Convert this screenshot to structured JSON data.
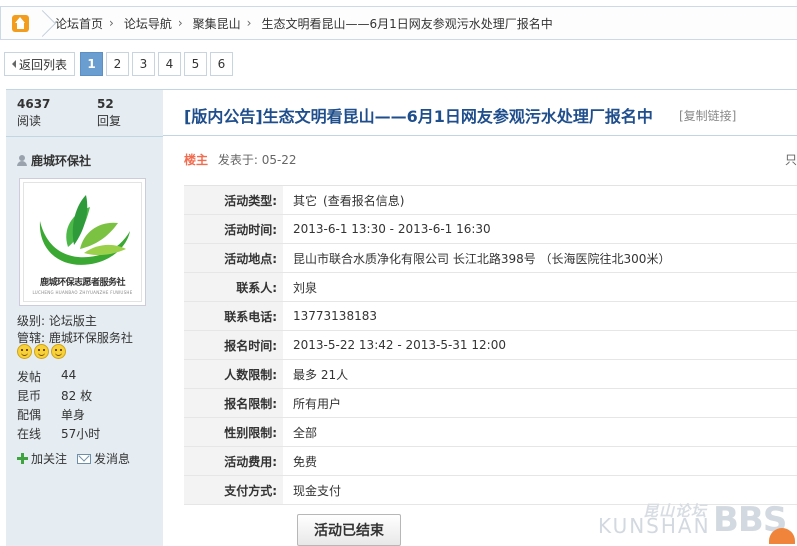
{
  "breadcrumb": {
    "items": [
      "论坛首页",
      "论坛导航",
      "聚集昆山",
      "生态文明看昆山——6月1日网友参观污水处理厂报名中"
    ],
    "separator": "›"
  },
  "pager": {
    "back_label": "返回列表",
    "pages": [
      "1",
      "2",
      "3",
      "4",
      "5",
      "6"
    ],
    "active_page": "1"
  },
  "stats": {
    "views_value": "4637",
    "views_label": "阅读",
    "replies_value": "52",
    "replies_label": "回复"
  },
  "author": {
    "name": "鹿城环保社",
    "avatar_text": "鹿城环保志愿者服务社",
    "avatar_subtext": "LUCHENG HUANBAO ZHIYUANZHE FUWUSHE",
    "level": "级别: 论坛版主",
    "manage": "管辖: 鹿城环保服务社",
    "fields": [
      {
        "key": "发帖",
        "value": "44"
      },
      {
        "key": "昆币",
        "value": "82 枚"
      },
      {
        "key": "配偶",
        "value": "单身"
      },
      {
        "key": "在线",
        "value": "57小时"
      }
    ],
    "follow_label": "加关注",
    "message_label": "发消息"
  },
  "thread": {
    "title": "[版内公告]生态文明看昆山——6月1日网友参观污水处理厂报名中",
    "copy_link": "[复制链接]"
  },
  "post": {
    "louzhu": "楼主",
    "posted": "发表于: 05-22",
    "right_fragment": "只"
  },
  "activity": {
    "rows": [
      {
        "key": "活动类型:",
        "value": "其它",
        "link": "(查看报名信息)"
      },
      {
        "key": "活动时间:",
        "value": "2013-6-1 13:30 - 2013-6-1 16:30"
      },
      {
        "key": "活动地点:",
        "value": "昆山市联合水质净化有限公司 长江北路398号 （长海医院往北300米）"
      },
      {
        "key": "联系人:",
        "value": "刘泉"
      },
      {
        "key": "联系电话:",
        "value": "13773138183"
      },
      {
        "key": "报名时间:",
        "value": "2013-5-22 13:42 - 2013-5-31 12:00"
      },
      {
        "key": "人数限制:",
        "value": "最多 21人"
      },
      {
        "key": "报名限制:",
        "value": "所有用户"
      },
      {
        "key": "性别限制:",
        "value": "全部"
      },
      {
        "key": "活动费用:",
        "value": "免费"
      },
      {
        "key": "支付方式:",
        "value": "现金支付"
      }
    ],
    "ended_label": "活动已结束"
  },
  "watermark": {
    "cn": "昆山论坛",
    "en": "KUNSHAN",
    "bbs": "BBS"
  },
  "colors": {
    "title_blue": "#1f4e8c",
    "louzhu_orange": "#f26c4f",
    "active_page": "#6a9dd0",
    "sidebar_bg": "#e5edf2",
    "logo_green": "#3aa832"
  }
}
